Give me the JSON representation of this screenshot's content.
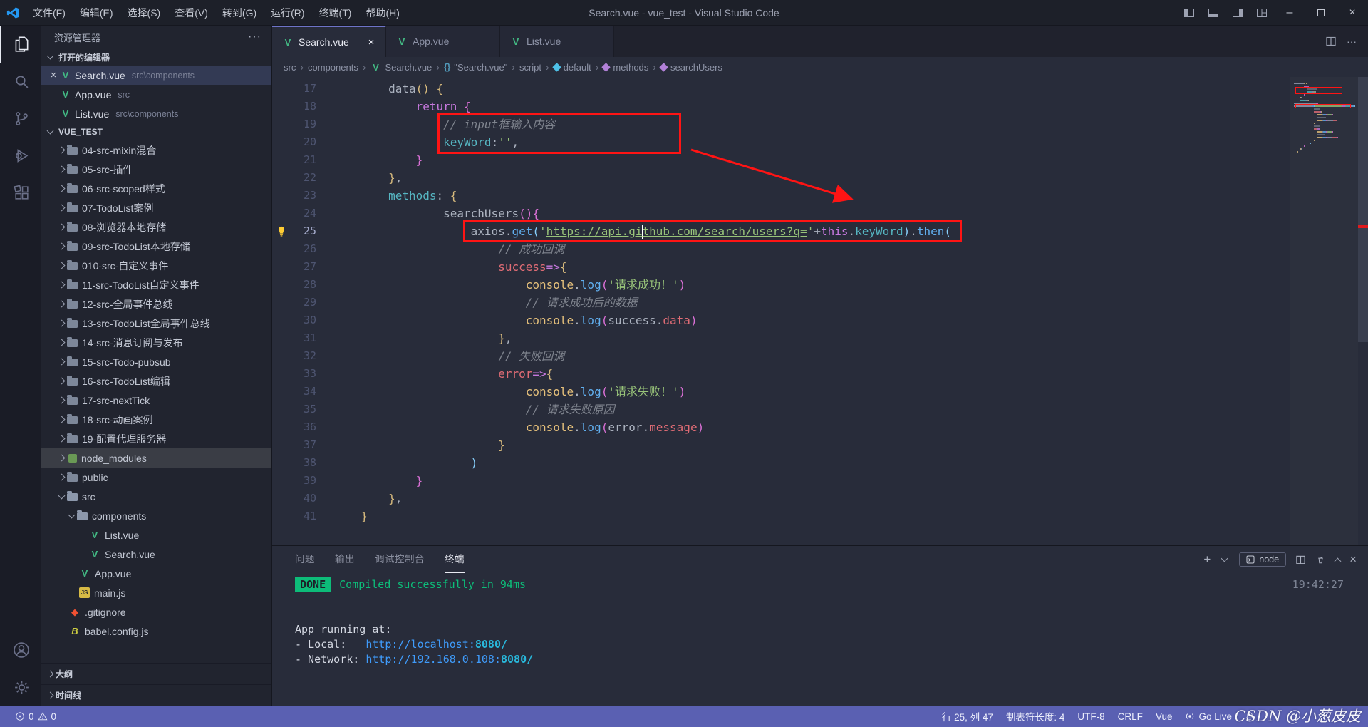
{
  "colors": {
    "accent": "#6e74c8",
    "statusbar": "#5a60b2",
    "annotation": "#ff1414",
    "terminal_green": "#0dbc79",
    "link": "#3f9bfa",
    "vue": "#42b883"
  },
  "window": {
    "title": "Search.vue - vue_test - Visual Studio Code",
    "menus": [
      "文件(F)",
      "编辑(E)",
      "选择(S)",
      "查看(V)",
      "转到(G)",
      "运行(R)",
      "终端(T)",
      "帮助(H)"
    ]
  },
  "sidebar": {
    "title": "资源管理器",
    "open_editors": {
      "label": "打开的编辑器",
      "items": [
        {
          "name": "Search.vue",
          "path": "src\\components",
          "active": true
        },
        {
          "name": "App.vue",
          "path": "src",
          "active": false
        },
        {
          "name": "List.vue",
          "path": "src\\components",
          "active": false
        }
      ]
    },
    "project_label": "VUE_TEST",
    "tree": [
      {
        "chev": "r",
        "icon": "folder",
        "label": "04-src-mixin混合",
        "lvl": 1
      },
      {
        "chev": "r",
        "icon": "folder",
        "label": "05-src-插件",
        "lvl": 1
      },
      {
        "chev": "r",
        "icon": "folder",
        "label": "06-src-scoped样式",
        "lvl": 1
      },
      {
        "chev": "r",
        "icon": "folder",
        "label": "07-TodoList案例",
        "lvl": 1
      },
      {
        "chev": "r",
        "icon": "folder",
        "label": "08-浏览器本地存储",
        "lvl": 1
      },
      {
        "chev": "r",
        "icon": "folder",
        "label": "09-src-TodoList本地存储",
        "lvl": 1
      },
      {
        "chev": "r",
        "icon": "folder",
        "label": "010-src-自定义事件",
        "lvl": 1
      },
      {
        "chev": "r",
        "icon": "folder",
        "label": "11-src-TodoList自定义事件",
        "lvl": 1
      },
      {
        "chev": "r",
        "icon": "folder",
        "label": "12-src-全局事件总线",
        "lvl": 1
      },
      {
        "chev": "r",
        "icon": "folder",
        "label": "13-src-TodoList全局事件总线",
        "lvl": 1
      },
      {
        "chev": "r",
        "icon": "folder",
        "label": "14-src-消息订阅与发布",
        "lvl": 1
      },
      {
        "chev": "r",
        "icon": "folder",
        "label": "15-src-Todo-pubsub",
        "lvl": 1
      },
      {
        "chev": "r",
        "icon": "folder",
        "label": "16-src-TodoList编辑",
        "lvl": 1
      },
      {
        "chev": "r",
        "icon": "folder",
        "label": "17-src-nextTick",
        "lvl": 1
      },
      {
        "chev": "r",
        "icon": "folder",
        "label": "18-src-动画案例",
        "lvl": 1
      },
      {
        "chev": "r",
        "icon": "folder",
        "label": "19-配置代理服务器",
        "lvl": 1
      },
      {
        "chev": "r",
        "icon": "npm",
        "label": "node_modules",
        "lvl": 1,
        "selected": true
      },
      {
        "chev": "r",
        "icon": "folder",
        "label": "public",
        "lvl": 1
      },
      {
        "chev": "d",
        "icon": "folder-open",
        "label": "src",
        "lvl": 1
      },
      {
        "chev": "d",
        "icon": "folder-open",
        "label": "components",
        "lvl": 2
      },
      {
        "icon": "vue",
        "label": "List.vue",
        "lvl": 3
      },
      {
        "icon": "vue",
        "label": "Search.vue",
        "lvl": 3
      },
      {
        "icon": "vue",
        "label": "App.vue",
        "lvl": 2
      },
      {
        "icon": "js",
        "label": "main.js",
        "lvl": 2
      },
      {
        "icon": "git",
        "label": ".gitignore",
        "lvl": 1
      },
      {
        "icon": "babel",
        "label": "babel.config.js",
        "lvl": 1
      }
    ],
    "outline_label": "大纲",
    "timeline_label": "时间线"
  },
  "tabs": [
    {
      "label": "Search.vue",
      "active": true
    },
    {
      "label": "App.vue",
      "active": false
    },
    {
      "label": "List.vue",
      "active": false
    }
  ],
  "breadcrumbs": [
    {
      "label": "src"
    },
    {
      "label": "components"
    },
    {
      "label": "Search.vue",
      "icon": "vue"
    },
    {
      "label": "\"Search.vue\"",
      "icon": "braces"
    },
    {
      "label": "script"
    },
    {
      "label": "default",
      "icon": "symbol-blue"
    },
    {
      "label": "methods",
      "icon": "symbol"
    },
    {
      "label": "searchUsers",
      "icon": "symbol"
    }
  ],
  "editor": {
    "lines": [
      {
        "n": 17,
        "t": [
          [
            "pl",
            "        data"
          ],
          [
            "b1",
            "("
          ],
          [
            "b1",
            ")"
          ],
          [
            "pl",
            " "
          ],
          [
            "b1",
            "{"
          ]
        ]
      },
      {
        "n": 18,
        "t": [
          [
            "pl",
            "            "
          ],
          [
            "kw",
            "return"
          ],
          [
            "pl",
            " "
          ],
          [
            "b2",
            "{"
          ]
        ]
      },
      {
        "n": 19,
        "t": [
          [
            "pl",
            "                "
          ],
          [
            "cm",
            "// input框输入内容"
          ]
        ]
      },
      {
        "n": 20,
        "t": [
          [
            "pl",
            "                "
          ],
          [
            "key",
            "keyWord"
          ],
          [
            "pl",
            ":"
          ],
          [
            "st",
            "''"
          ],
          [
            "pl",
            ","
          ]
        ]
      },
      {
        "n": 21,
        "t": [
          [
            "pl",
            "            "
          ],
          [
            "b2",
            "}"
          ]
        ]
      },
      {
        "n": 22,
        "t": [
          [
            "pl",
            "        "
          ],
          [
            "b1",
            "}"
          ],
          [
            "pl",
            ","
          ]
        ]
      },
      {
        "n": 23,
        "t": [
          [
            "pl",
            "        "
          ],
          [
            "key",
            "methods"
          ],
          [
            "pl",
            ": "
          ],
          [
            "b1",
            "{"
          ]
        ]
      },
      {
        "n": 24,
        "t": [
          [
            "pl",
            "                searchUsers"
          ],
          [
            "b2",
            "("
          ],
          [
            "b2",
            ")"
          ],
          [
            "b2",
            "{"
          ]
        ]
      },
      {
        "n": 25,
        "bulb": true,
        "active": true,
        "t": [
          [
            "pl",
            "                    axios."
          ],
          [
            "fn",
            "get"
          ],
          [
            "b3",
            "("
          ],
          [
            "st",
            "'"
          ],
          [
            "stl",
            "https://api.gi"
          ],
          [
            "cursor",
            ""
          ],
          [
            "stl",
            "thub.com/search/users?q="
          ],
          [
            "st",
            "'"
          ],
          [
            "pl",
            "+"
          ],
          [
            "kw",
            "this"
          ],
          [
            "pl",
            "."
          ],
          [
            "key",
            "keyWord"
          ],
          [
            "b3",
            ")"
          ],
          [
            "pl",
            "."
          ],
          [
            "fn",
            "then"
          ],
          [
            "b3",
            "("
          ]
        ]
      },
      {
        "n": 26,
        "t": [
          [
            "pl",
            "                        "
          ],
          [
            "cm",
            "// 成功回调"
          ]
        ]
      },
      {
        "n": 27,
        "t": [
          [
            "pl",
            "                        "
          ],
          [
            "par",
            "success"
          ],
          [
            "kw",
            "=>"
          ],
          [
            "b1",
            "{"
          ]
        ]
      },
      {
        "n": 28,
        "t": [
          [
            "pl",
            "                            "
          ],
          [
            "obj",
            "console"
          ],
          [
            "pl",
            "."
          ],
          [
            "fn",
            "log"
          ],
          [
            "b2",
            "("
          ],
          [
            "st",
            "'请求成功！'"
          ],
          [
            "b2",
            ")"
          ]
        ]
      },
      {
        "n": 29,
        "t": [
          [
            "pl",
            "                            "
          ],
          [
            "cm",
            "// 请求成功后的数据"
          ]
        ]
      },
      {
        "n": 30,
        "t": [
          [
            "pl",
            "                            "
          ],
          [
            "obj",
            "console"
          ],
          [
            "pl",
            "."
          ],
          [
            "fn",
            "log"
          ],
          [
            "b2",
            "("
          ],
          [
            "pl",
            "success."
          ],
          [
            "prop",
            "data"
          ],
          [
            "b2",
            ")"
          ]
        ]
      },
      {
        "n": 31,
        "t": [
          [
            "pl",
            "                        "
          ],
          [
            "b1",
            "}"
          ],
          [
            "pl",
            ","
          ]
        ]
      },
      {
        "n": 32,
        "t": [
          [
            "pl",
            "                        "
          ],
          [
            "cm",
            "// 失败回调"
          ]
        ]
      },
      {
        "n": 33,
        "t": [
          [
            "pl",
            "                        "
          ],
          [
            "par",
            "error"
          ],
          [
            "kw",
            "=>"
          ],
          [
            "b1",
            "{"
          ]
        ]
      },
      {
        "n": 34,
        "t": [
          [
            "pl",
            "                            "
          ],
          [
            "obj",
            "console"
          ],
          [
            "pl",
            "."
          ],
          [
            "fn",
            "log"
          ],
          [
            "b2",
            "("
          ],
          [
            "st",
            "'请求失败！'"
          ],
          [
            "b2",
            ")"
          ]
        ]
      },
      {
        "n": 35,
        "t": [
          [
            "pl",
            "                            "
          ],
          [
            "cm",
            "// 请求失败原因"
          ]
        ]
      },
      {
        "n": 36,
        "t": [
          [
            "pl",
            "                            "
          ],
          [
            "obj",
            "console"
          ],
          [
            "pl",
            "."
          ],
          [
            "fn",
            "log"
          ],
          [
            "b2",
            "("
          ],
          [
            "pl",
            "error."
          ],
          [
            "prop",
            "message"
          ],
          [
            "b2",
            ")"
          ]
        ]
      },
      {
        "n": 37,
        "t": [
          [
            "pl",
            "                        "
          ],
          [
            "b1",
            "}"
          ]
        ]
      },
      {
        "n": 38,
        "t": [
          [
            "pl",
            "                    "
          ],
          [
            "b3",
            ")"
          ]
        ]
      },
      {
        "n": 39,
        "t": [
          [
            "pl",
            "            "
          ],
          [
            "b2",
            "}"
          ]
        ]
      },
      {
        "n": 40,
        "t": [
          [
            "pl",
            "        "
          ],
          [
            "b1",
            "}"
          ],
          [
            "pl",
            ","
          ]
        ]
      },
      {
        "n": 41,
        "t": [
          [
            "pl",
            "    "
          ],
          [
            "b1",
            "}"
          ]
        ]
      }
    ]
  },
  "panel": {
    "tabs": [
      "问题",
      "输出",
      "调试控制台",
      "终端"
    ],
    "active_tab": "终端",
    "node_label": "node",
    "terminal": {
      "done_badge": "DONE",
      "compile_msg": "Compiled successfully in 94ms",
      "time": "19:42:27",
      "app_running": "App running at:",
      "local_label": "- Local:   ",
      "local_url": "http://localhost:",
      "local_port": "8080/",
      "network_label": "- Network: ",
      "network_url": "http://192.168.0.108:",
      "network_port": "8080/"
    }
  },
  "statusbar": {
    "errors": "0",
    "warnings": "0",
    "cursor": "行 25, 列 47",
    "tabsize": "制表符长度: 4",
    "encoding": "UTF-8",
    "eol": "CRLF",
    "lang": "Vue",
    "golive": "Go Live",
    "watermark": "CSDN @小葱皮皮"
  }
}
